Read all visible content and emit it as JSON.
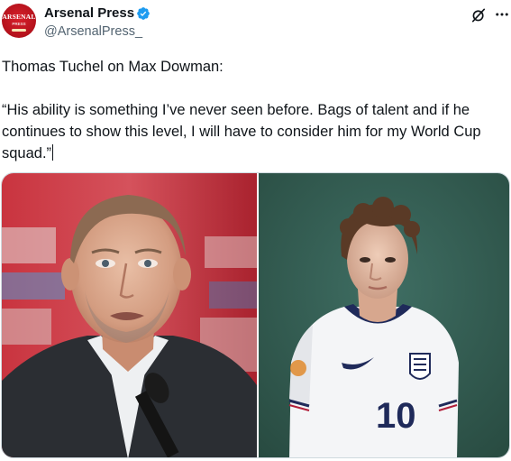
{
  "author": {
    "display_name": "Arsenal Press",
    "handle": "@ArsenalPress_",
    "avatar": {
      "text": "ARSENAL",
      "subtext": "PRESS",
      "color": "#c8161f"
    },
    "verified": true,
    "verified_color": "#1d9bf0"
  },
  "icons": {
    "grok": "grok-icon",
    "more": "more-options-icon"
  },
  "tweet": {
    "line1": "Thomas Tuchel on Max Dowman:",
    "line2": "“His ability is something I’ve never seen before. Bags of talent and if he continues to show this level, I will have to consider him for my World Cup squad.”"
  },
  "media": [
    {
      "subject": "Thomas Tuchel at press conference",
      "type": "photo"
    },
    {
      "subject": "Max Dowman in England shirt",
      "type": "photo",
      "shirt_number": "10"
    }
  ]
}
